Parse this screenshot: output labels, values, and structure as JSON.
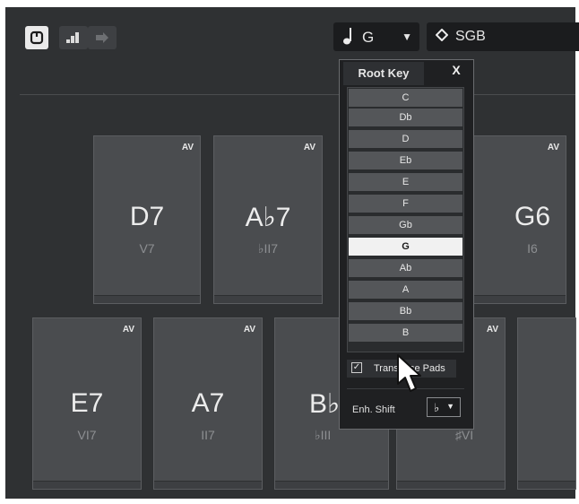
{
  "toolbar": {
    "key_note_icon": "note-icon",
    "key_value": "G",
    "key_arrow": "▼",
    "scale_icon": "diamond-icon",
    "scale_value": "SGB"
  },
  "pads": {
    "row1": [
      {
        "av": "AV",
        "chord": "D7",
        "degree": "V7"
      },
      {
        "av": "AV",
        "chord": "A♭7",
        "degree": "♭II7"
      },
      {
        "av": "AV",
        "chord": "G6",
        "degree": "I6"
      }
    ],
    "row2": [
      {
        "av": "AV",
        "chord": "E7",
        "degree": "VI7"
      },
      {
        "av": "AV",
        "chord": "A7",
        "degree": "II7"
      },
      {
        "chord": "B♭",
        "degree": "♭III"
      },
      {
        "av": "AV",
        "degree": "♯VI"
      },
      {}
    ]
  },
  "root_key_popup": {
    "tab_label": "Root Key",
    "close_label": "X",
    "keys": [
      "C",
      "Db",
      "D",
      "Eb",
      "E",
      "F",
      "Gb",
      "G",
      "Ab",
      "A",
      "Bb",
      "B"
    ],
    "selected_key": "G",
    "transpose_checked": true,
    "transpose_label": "Transpose Pads",
    "enh_shift_label": "Enh. Shift",
    "enh_shift_value": "♭",
    "enh_shift_arrow": "▼"
  }
}
